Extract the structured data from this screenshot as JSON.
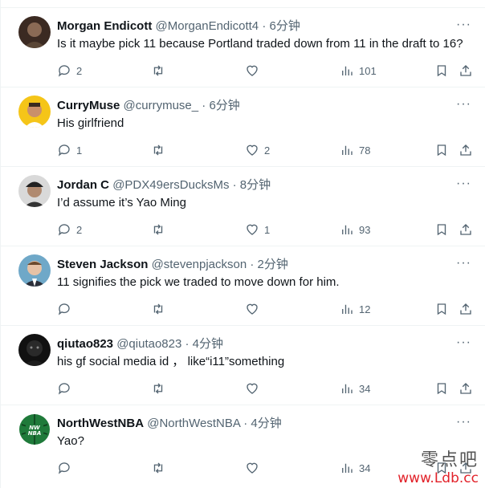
{
  "tweets": [
    {
      "name": "Morgan Endicott",
      "handle": "@MorganEndicott4",
      "time": "6分钟",
      "text": "Is it maybe pick 11 because Portland traded down from 11 in the draft to 16?",
      "replies": "2",
      "retweets": "",
      "likes": "",
      "views": "101"
    },
    {
      "name": "CurryMuse",
      "handle": "@currymuse_",
      "time": "6分钟",
      "text": "His girlfriend",
      "replies": "1",
      "retweets": "",
      "likes": "2",
      "views": "78"
    },
    {
      "name": "Jordan C",
      "handle": "@PDX49ersDucksMs",
      "time": "8分钟",
      "text": "I’d assume it’s Yao Ming",
      "replies": "2",
      "retweets": "",
      "likes": "1",
      "views": "93"
    },
    {
      "name": "Steven Jackson",
      "handle": "@stevenpjackson",
      "time": "2分钟",
      "text": "11 signifies the pick we traded to move down for him.",
      "replies": "",
      "retweets": "",
      "likes": "",
      "views": "12"
    },
    {
      "name": "qiutao823",
      "handle": "@qiutao823",
      "time": "4分钟",
      "text": "his gf social media id ， like“i11”something",
      "replies": "",
      "retweets": "",
      "likes": "",
      "views": "34"
    },
    {
      "name": "NorthWestNBA",
      "handle": "@NorthWestNBA",
      "time": "4分钟",
      "text": "Yao?",
      "replies": "",
      "retweets": "",
      "likes": "",
      "views": "34"
    }
  ],
  "separator": "·",
  "more_glyph": "···",
  "icons": {
    "reply": "reply-icon",
    "retweet": "retweet-icon",
    "like": "heart-icon",
    "views": "views-icon",
    "bookmark": "bookmark-icon",
    "share": "share-icon"
  },
  "colors": {
    "text_primary": "#0f1419",
    "text_secondary": "#536471",
    "divider": "#eff3f4",
    "watermark_url": "#e2222a"
  },
  "watermark": {
    "chinese": "零点吧",
    "url": "www.Ldb.cc"
  }
}
